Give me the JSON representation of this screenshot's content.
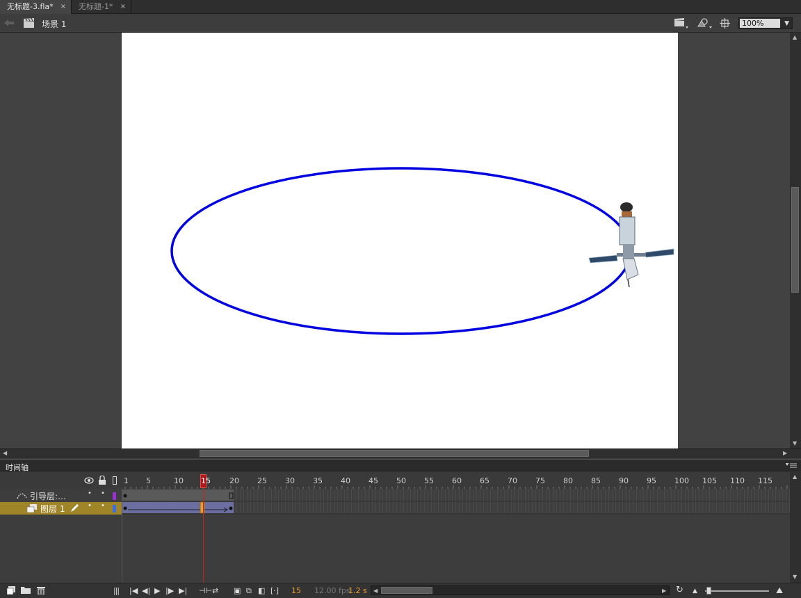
{
  "tabs": [
    {
      "label": "无标题-3.fla*",
      "close": "×",
      "active": true
    },
    {
      "label": "无标题-1*",
      "close": "×",
      "active": false
    }
  ],
  "toolbar": {
    "scene_label": "场景 1",
    "zoom_value": "100%",
    "icons": [
      "back-arrow-icon",
      "clapperboard-icon",
      "edit-scene-icon",
      "edit-symbol-icon",
      "center-stage-icon"
    ]
  },
  "timeline": {
    "panel_title": "时间轴",
    "ruler_numbers": [
      "1",
      "5",
      "10",
      "15",
      "20",
      "25",
      "30",
      "35",
      "40",
      "45",
      "50",
      "55",
      "60",
      "65",
      "70",
      "75",
      "80",
      "85",
      "90",
      "95",
      "100",
      "105",
      "110",
      "115"
    ],
    "current_frame_marker": "15",
    "layers": [
      {
        "name": "引导层:…",
        "type": "guide",
        "color": "#9b30d0"
      },
      {
        "name": "图层 1",
        "type": "normal",
        "color": "#3a6fe0",
        "selected": true
      }
    ],
    "status": {
      "frame": "15",
      "fps": "12.00 fps",
      "time": "1.2 s"
    }
  },
  "colors": {
    "accent_frame": "#f0a030",
    "guide_path": "#0000e0",
    "selected_layer_bg": "#a08428",
    "playhead": "#cc2020"
  }
}
